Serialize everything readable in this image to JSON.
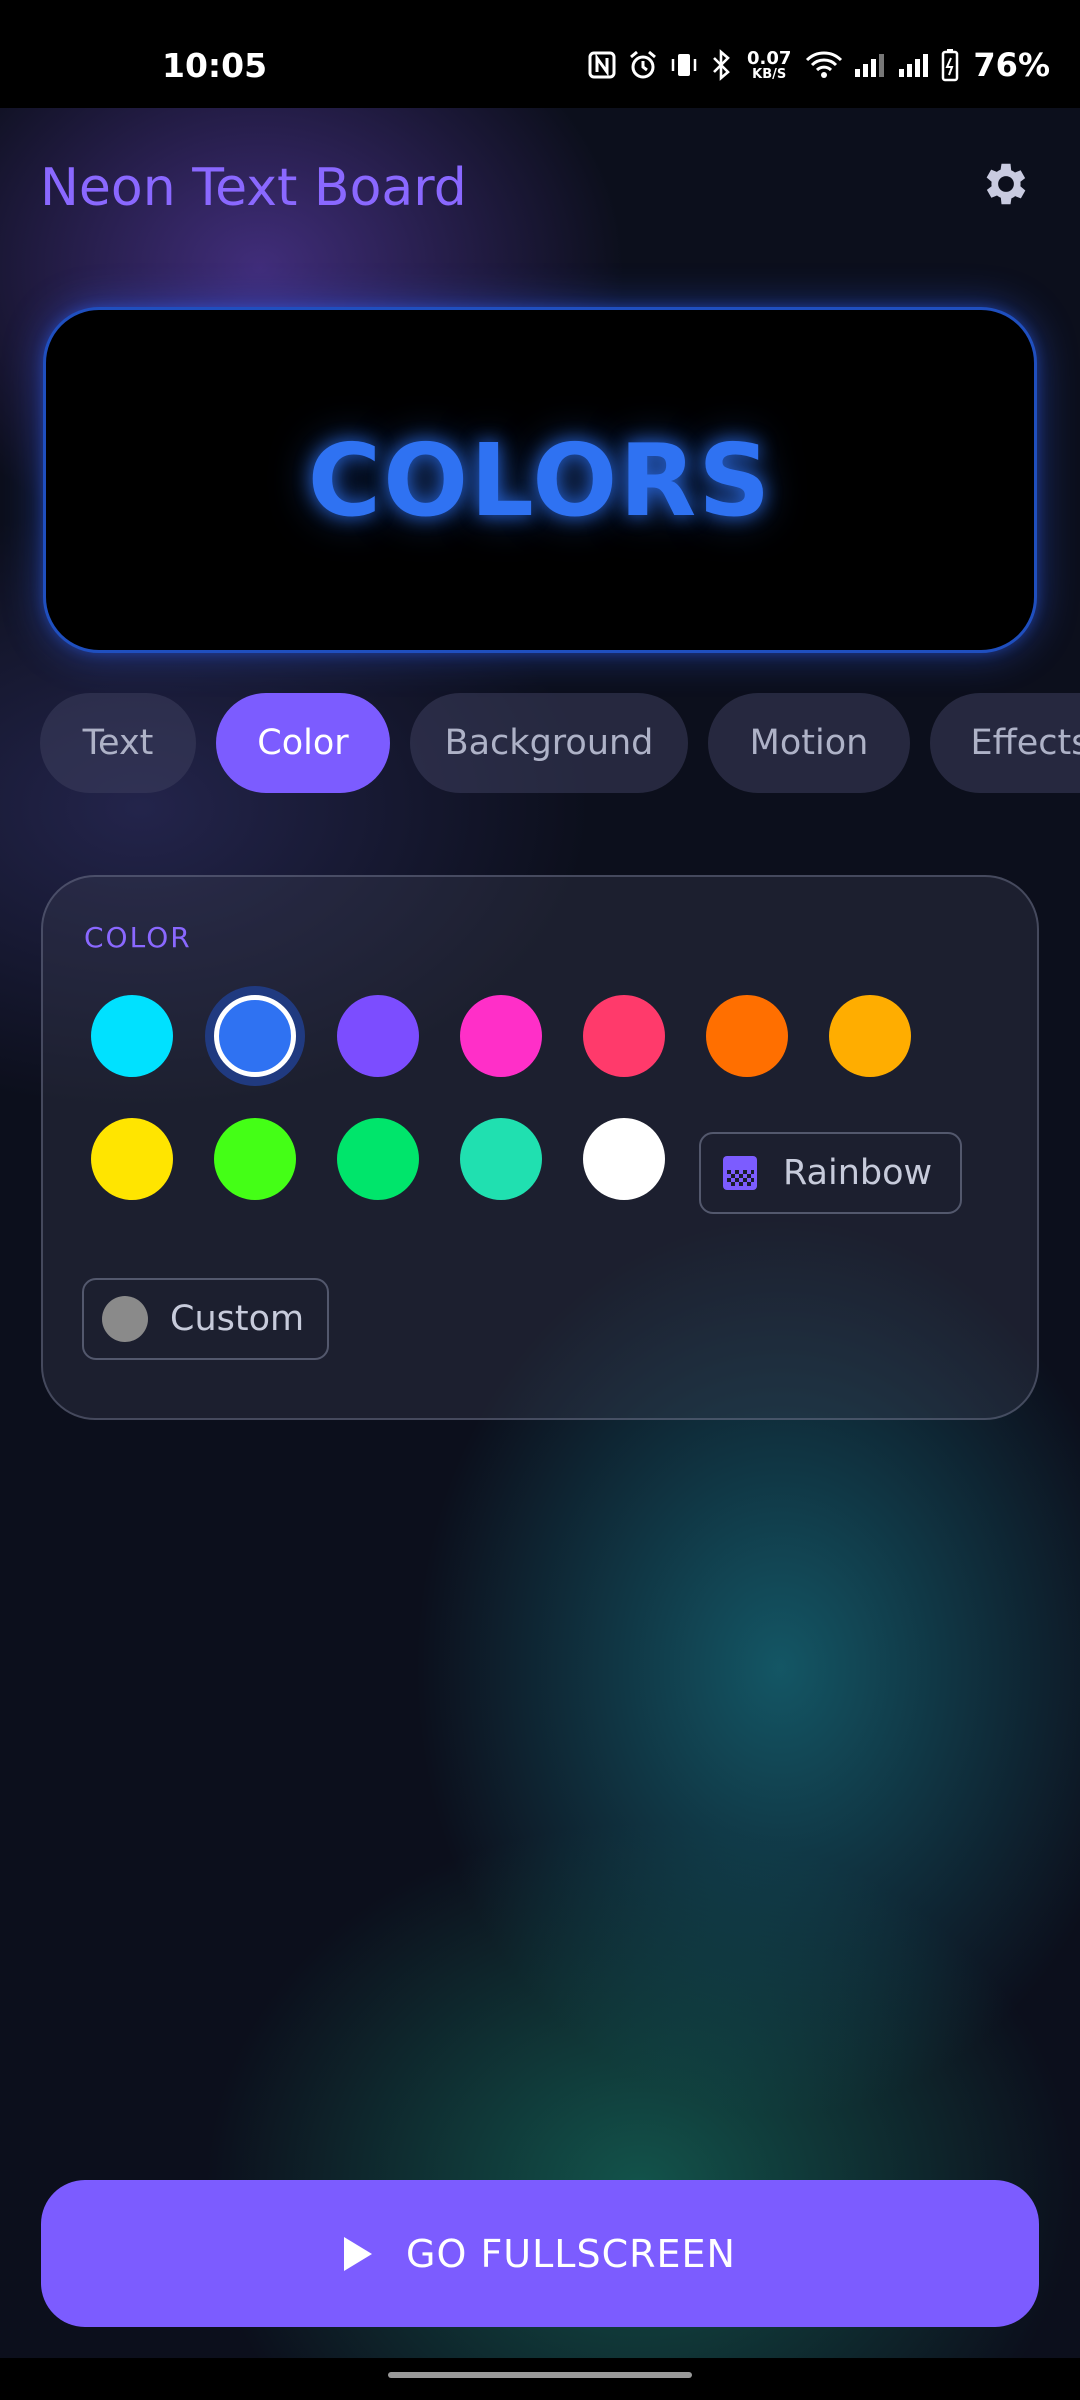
{
  "status_bar": {
    "time": "10:05",
    "speed_value": "0.07",
    "speed_unit": "KB/S",
    "battery": "76%"
  },
  "header": {
    "title": "Neon Text Board",
    "settings_icon": "gear-icon"
  },
  "preview": {
    "text": "COLORS",
    "text_color": "#2f72f2"
  },
  "tabs": [
    {
      "label": "Text",
      "active": false
    },
    {
      "label": "Color",
      "active": true
    },
    {
      "label": "Background",
      "active": false
    },
    {
      "label": "Motion",
      "active": false
    },
    {
      "label": "Effects",
      "active": false
    }
  ],
  "color_panel": {
    "label": "COLOR",
    "swatches": [
      {
        "color": "#00e1ff",
        "selected": false
      },
      {
        "color": "#2f72f2",
        "selected": true
      },
      {
        "color": "#7c4dff",
        "selected": false
      },
      {
        "color": "#ff2fc8",
        "selected": false
      },
      {
        "color": "#ff3a6b",
        "selected": false
      },
      {
        "color": "#ff6f00",
        "selected": false
      },
      {
        "color": "#ffad00",
        "selected": false
      },
      {
        "color": "#ffe500",
        "selected": false
      },
      {
        "color": "#44ff16",
        "selected": false
      },
      {
        "color": "#00e56b",
        "selected": false
      },
      {
        "color": "#20e0b0",
        "selected": false
      },
      {
        "color": "#ffffff",
        "selected": false
      }
    ],
    "rainbow_label": "Rainbow",
    "custom_label": "Custom"
  },
  "fullscreen_button": {
    "label": "GO FULLSCREEN"
  },
  "colors": {
    "accent": "#7c5cff",
    "title": "#8a68ff"
  }
}
